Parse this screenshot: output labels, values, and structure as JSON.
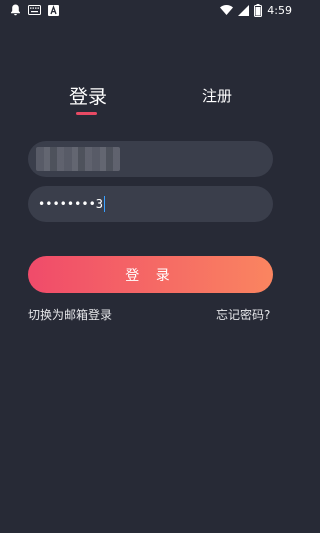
{
  "status_bar": {
    "time": "4:59",
    "icons": [
      "bell-icon",
      "keyboard-icon",
      "a-icon",
      "wifi-icon",
      "signal-icon",
      "battery-icon"
    ]
  },
  "tabs": {
    "login": "登录",
    "register": "注册",
    "active": "login"
  },
  "form": {
    "username_value": "",
    "password_value": "••••••••3"
  },
  "login_button": "登 录",
  "links": {
    "email_login": "切换为邮箱登录",
    "forgot_password": "忘记密码?"
  },
  "colors": {
    "background": "#272a36",
    "field_bg": "#3a3e4b",
    "accent_start": "#f04b6a",
    "accent_end": "#fa8560",
    "tab_underline": "#e84a64",
    "caret": "#39a0ff"
  }
}
